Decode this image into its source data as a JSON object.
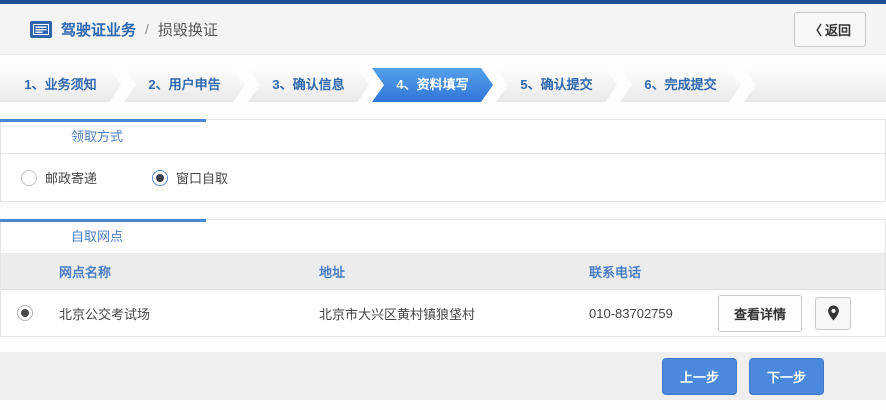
{
  "header": {
    "title_primary": "驾驶证业务",
    "title_separator": "/",
    "title_secondary": "损毁换证",
    "back_chevron": "〈",
    "back_label": "返回"
  },
  "steps": [
    {
      "label": "1、业务须知",
      "active": false
    },
    {
      "label": "2、用户申告",
      "active": false
    },
    {
      "label": "3、确认信息",
      "active": false
    },
    {
      "label": "4、资料填写",
      "active": true
    },
    {
      "label": "5、确认提交",
      "active": false
    },
    {
      "label": "6、完成提交",
      "active": false
    }
  ],
  "pickup_section": {
    "title": "领取方式",
    "options": [
      {
        "label": "邮政寄递",
        "selected": false
      },
      {
        "label": "窗口自取",
        "selected": true
      }
    ]
  },
  "network_section": {
    "title": "自取网点",
    "columns": [
      "网点名称",
      "地址",
      "联系电话"
    ],
    "rows": [
      {
        "selected": true,
        "name": "北京公交考试场",
        "address": "北京市大兴区黄村镇狼垡村",
        "phone": "010-83702759",
        "detail_label": "查看详情"
      }
    ]
  },
  "footer": {
    "prev_label": "上一步",
    "next_label": "下一步"
  },
  "colors": {
    "top_strip": "#1e4e8f",
    "accent_blue": "#4a86d1",
    "step_active_blue": "#3076d9",
    "link_blue": "#2b67b1",
    "button_blue": "#4a89dc"
  }
}
